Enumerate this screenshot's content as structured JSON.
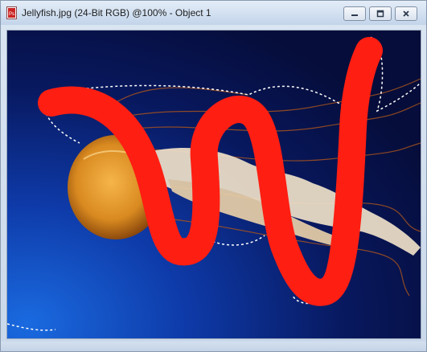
{
  "window": {
    "title": "Jellyfish.jpg (24-Bit RGB) @100% - Object 1",
    "icons": {
      "document": "image-document-icon",
      "minimize": "minimize-icon",
      "maximize": "maximize-icon",
      "close": "close-icon"
    }
  },
  "canvas": {
    "image_name": "Jellyfish.jpg",
    "background_color": "#0a1450",
    "stroke_color": "#ff1e12",
    "selection_marquee": "dashed-white"
  }
}
